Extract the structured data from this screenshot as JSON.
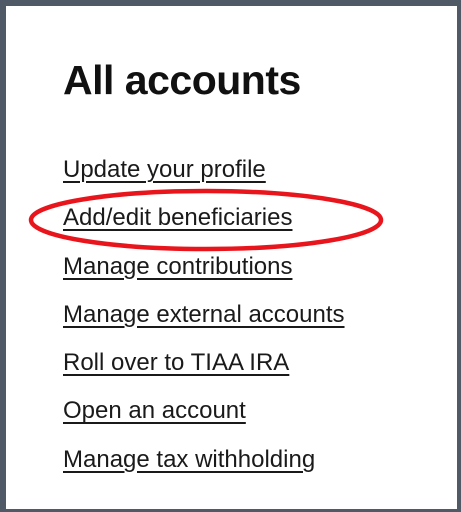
{
  "panel": {
    "title": "All accounts",
    "links": [
      {
        "label": "Update your profile"
      },
      {
        "label": "Add/edit beneficiaries",
        "highlighted": true
      },
      {
        "label": "Manage contributions"
      },
      {
        "label": "Manage external accounts"
      },
      {
        "label": "Roll over to TIAA IRA"
      },
      {
        "label": "Open an account"
      },
      {
        "label": "Manage tax withholding"
      }
    ]
  },
  "colors": {
    "border": "#505a66",
    "text": "#1a1a1a",
    "highlight_ring": "#e8151c"
  }
}
